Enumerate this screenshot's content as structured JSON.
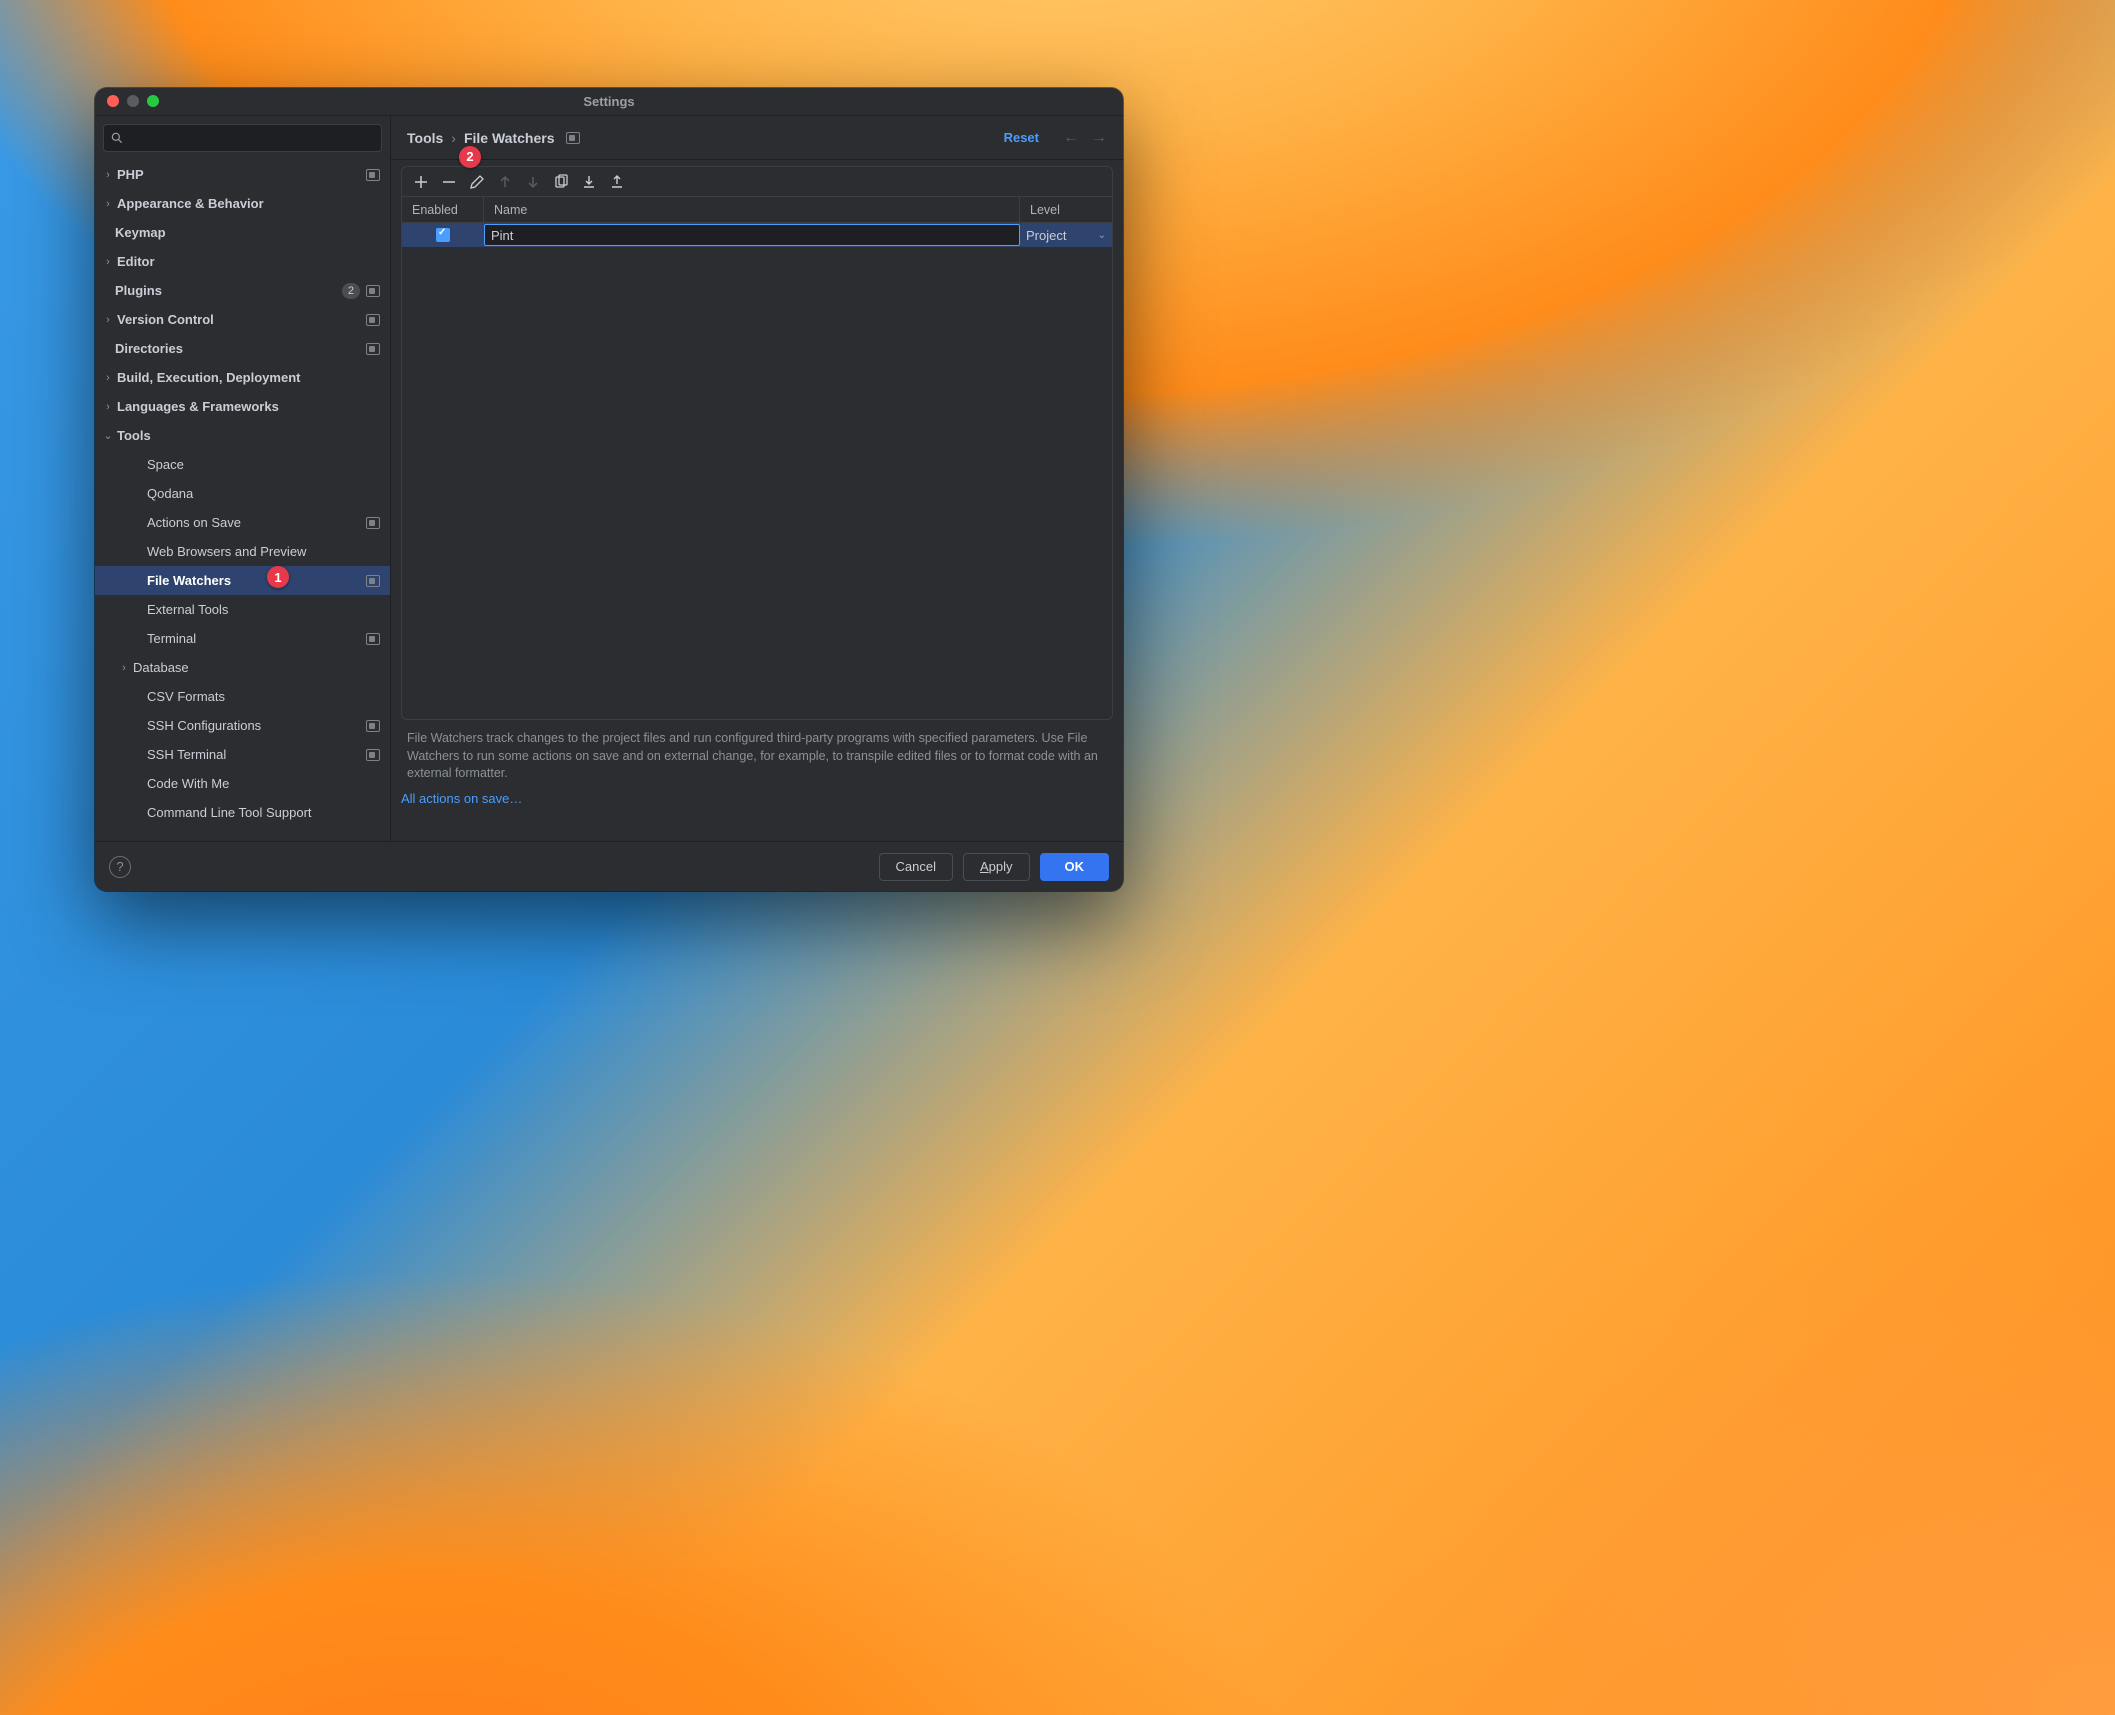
{
  "title": "Settings",
  "search_placeholder": "",
  "sidebar": {
    "items": [
      {
        "label": "PHP",
        "bold": true,
        "chev": "›",
        "proj": true,
        "indent": 0
      },
      {
        "label": "Appearance & Behavior",
        "bold": true,
        "chev": "›",
        "proj": false,
        "indent": 0
      },
      {
        "label": "Keymap",
        "bold": true,
        "chev": "",
        "proj": false,
        "indent": 0,
        "pad": true
      },
      {
        "label": "Editor",
        "bold": true,
        "chev": "›",
        "proj": false,
        "indent": 0
      },
      {
        "label": "Plugins",
        "bold": true,
        "chev": "",
        "proj": true,
        "indent": 0,
        "pad": true,
        "badge": "2"
      },
      {
        "label": "Version Control",
        "bold": true,
        "chev": "›",
        "proj": true,
        "indent": 0
      },
      {
        "label": "Directories",
        "bold": true,
        "chev": "",
        "proj": true,
        "indent": 0,
        "pad": true
      },
      {
        "label": "Build, Execution, Deployment",
        "bold": true,
        "chev": "›",
        "proj": false,
        "indent": 0
      },
      {
        "label": "Languages & Frameworks",
        "bold": true,
        "chev": "›",
        "proj": false,
        "indent": 0
      },
      {
        "label": "Tools",
        "bold": true,
        "chev": "⌄",
        "proj": false,
        "indent": 0
      },
      {
        "label": "Space",
        "bold": false,
        "chev": "",
        "proj": false,
        "indent": 2
      },
      {
        "label": "Qodana",
        "bold": false,
        "chev": "",
        "proj": false,
        "indent": 2
      },
      {
        "label": "Actions on Save",
        "bold": false,
        "chev": "",
        "proj": true,
        "indent": 2
      },
      {
        "label": "Web Browsers and Preview",
        "bold": false,
        "chev": "",
        "proj": false,
        "indent": 2
      },
      {
        "label": "File Watchers",
        "bold": false,
        "chev": "",
        "proj": true,
        "indent": 2,
        "selected": true
      },
      {
        "label": "External Tools",
        "bold": false,
        "chev": "",
        "proj": false,
        "indent": 2
      },
      {
        "label": "Terminal",
        "bold": false,
        "chev": "",
        "proj": true,
        "indent": 2
      },
      {
        "label": "Database",
        "bold": false,
        "chev": "›",
        "proj": false,
        "indent": 1
      },
      {
        "label": "CSV Formats",
        "bold": false,
        "chev": "",
        "proj": false,
        "indent": 2
      },
      {
        "label": "SSH Configurations",
        "bold": false,
        "chev": "",
        "proj": true,
        "indent": 2
      },
      {
        "label": "SSH Terminal",
        "bold": false,
        "chev": "",
        "proj": true,
        "indent": 2
      },
      {
        "label": "Code With Me",
        "bold": false,
        "chev": "",
        "proj": false,
        "indent": 2
      },
      {
        "label": "Command Line Tool Support",
        "bold": false,
        "chev": "",
        "proj": false,
        "indent": 2
      }
    ]
  },
  "breadcrumb": {
    "parent": "Tools",
    "current": "File Watchers"
  },
  "reset_label": "Reset",
  "columns": {
    "enabled": "Enabled",
    "name": "Name",
    "level": "Level"
  },
  "rows": [
    {
      "enabled": true,
      "name": "Pint",
      "level": "Project"
    }
  ],
  "description": "File Watchers track changes to the project files and run configured third-party programs with specified parameters. Use File Watchers to run some actions on save and on external change, for example, to transpile edited files or to format code with an external formatter.",
  "link": "All actions on save…",
  "buttons": {
    "cancel": "Cancel",
    "apply": "Apply",
    "ok": "OK",
    "apply_ul": "A",
    "apply_rest": "pply"
  },
  "callouts": {
    "one": "1",
    "two": "2"
  }
}
